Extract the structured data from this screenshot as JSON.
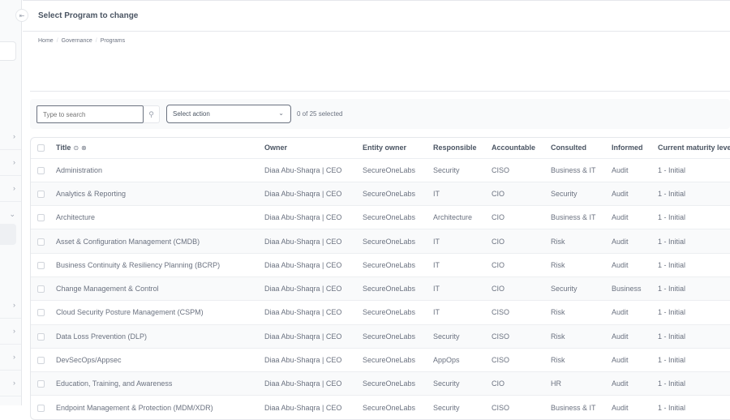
{
  "header": {
    "title": "Select Program to change"
  },
  "breadcrumb": [
    "Home",
    "Governance",
    "Programs"
  ],
  "toolbar": {
    "search_placeholder": "Type to search",
    "action_select": "Select action",
    "selection_count": "0 of 25 selected"
  },
  "icons": {
    "collapse": "⇤",
    "search": "⚲",
    "caret": "⌄",
    "chevron_right": "›",
    "chevron_down": "⌄",
    "sort_asc": "⊙",
    "remove_sort": "⊗"
  },
  "table": {
    "columns": [
      "Title",
      "Owner",
      "Entity owner",
      "Responsible",
      "Accountable",
      "Consulted",
      "Informed",
      "Current maturity level"
    ],
    "rows": [
      [
        "Administration",
        "Diaa Abu-Shaqra | CEO",
        "SecureOneLabs",
        "Security",
        "CISO",
        "Business & IT",
        "Audit",
        "1 - Initial"
      ],
      [
        "Analytics & Reporting",
        "Diaa Abu-Shaqra | CEO",
        "SecureOneLabs",
        "IT",
        "CIO",
        "Security",
        "Audit",
        "1 - Initial"
      ],
      [
        "Architecture",
        "Diaa Abu-Shaqra | CEO",
        "SecureOneLabs",
        "Architecture",
        "CIO",
        "Business & IT",
        "Audit",
        "1 - Initial"
      ],
      [
        "Asset & Configuration Management (CMDB)",
        "Diaa Abu-Shaqra | CEO",
        "SecureOneLabs",
        "IT",
        "CIO",
        "Risk",
        "Audit",
        "1 - Initial"
      ],
      [
        "Business Continuity & Resiliency Planning (BCRP)",
        "Diaa Abu-Shaqra | CEO",
        "SecureOneLabs",
        "IT",
        "CIO",
        "Risk",
        "Audit",
        "1 - Initial"
      ],
      [
        "Change Management & Control",
        "Diaa Abu-Shaqra | CEO",
        "SecureOneLabs",
        "IT",
        "CIO",
        "Security",
        "Business",
        "1 - Initial"
      ],
      [
        "Cloud Security Posture Management (CSPM)",
        "Diaa Abu-Shaqra | CEO",
        "SecureOneLabs",
        "IT",
        "CISO",
        "Risk",
        "Audit",
        "1 - Initial"
      ],
      [
        "Data Loss Prevention (DLP)",
        "Diaa Abu-Shaqra | CEO",
        "SecureOneLabs",
        "Security",
        "CISO",
        "Risk",
        "Audit",
        "1 - Initial"
      ],
      [
        "DevSecOps/Appsec",
        "Diaa Abu-Shaqra | CEO",
        "SecureOneLabs",
        "AppOps",
        "CISO",
        "Risk",
        "Audit",
        "1 - Initial"
      ],
      [
        "Education, Training, and Awareness",
        "Diaa Abu-Shaqra | CEO",
        "SecureOneLabs",
        "Security",
        "CIO",
        "HR",
        "Audit",
        "1 - Initial"
      ],
      [
        "Endpoint Management & Protection (MDM/XDR)",
        "Diaa Abu-Shaqra | CEO",
        "SecureOneLabs",
        "Security",
        "CISO",
        "Business & IT",
        "Audit",
        "1 - Initial"
      ]
    ]
  }
}
